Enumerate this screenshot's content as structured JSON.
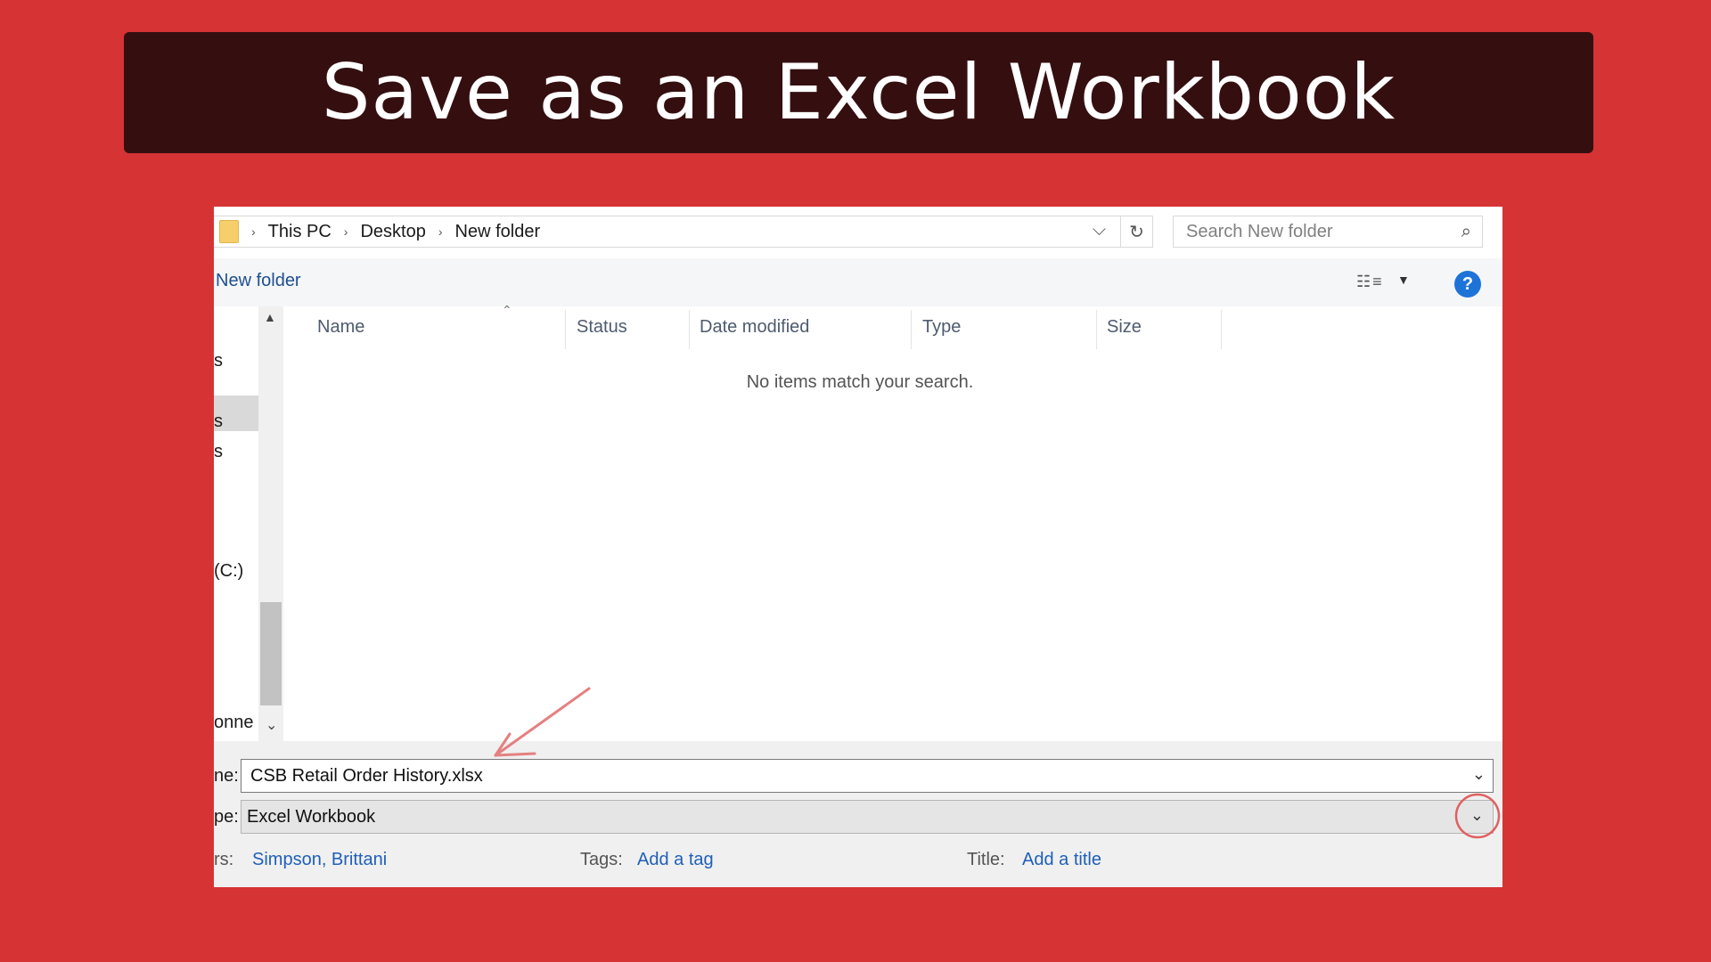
{
  "banner": {
    "title": "Save as an Excel Workbook"
  },
  "address": {
    "crumbs": [
      "This PC",
      "Desktop",
      "New folder"
    ],
    "separator": "›",
    "dropdown_glyph": "⌵",
    "refresh_glyph": "↻"
  },
  "search": {
    "placeholder": "Search New folder"
  },
  "toolbar": {
    "new_folder_label": "New folder",
    "help_glyph": "?"
  },
  "nav": {
    "items": [
      "s",
      "s",
      "s",
      "(C:)",
      "onne"
    ]
  },
  "list": {
    "columns": [
      "Name",
      "Status",
      "Date modified",
      "Type",
      "Size"
    ],
    "empty_message": "No items match your search."
  },
  "form": {
    "filename_label_fragment": "ne:",
    "filename_value": "CSB Retail Order History.xlsx",
    "filetype_label_fragment": "pe:",
    "filetype_value": "Excel Workbook",
    "authors_label_fragment": "rs:",
    "authors_value": "Simpson, Brittani",
    "tags_label": "Tags:",
    "tags_value": "Add a tag",
    "title_label": "Title:",
    "title_value": "Add a title"
  },
  "colors": {
    "background": "#d63335",
    "banner": "#350f10",
    "link": "#1f5fb8",
    "annotation": "#e06060"
  }
}
